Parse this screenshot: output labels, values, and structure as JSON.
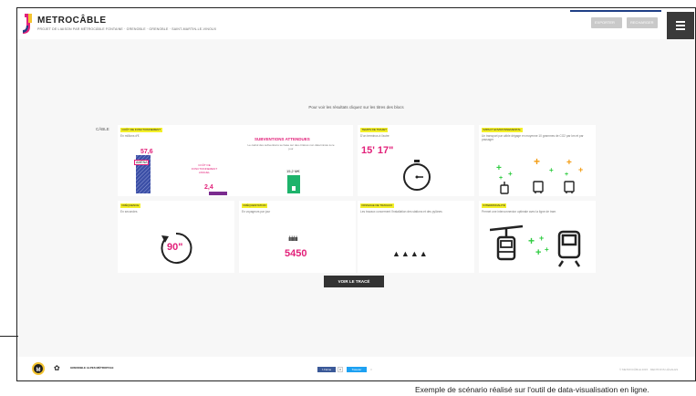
{
  "header": {
    "title": "METROCÂBLE",
    "subtitle": "PROJET DE LIAISON PAR MÉTROCÂBLE FONTAINE · GRENOBLE · GRENOBLE · SAINT-MARTIN-LE-VINOUX",
    "export_label": "EXPORTER",
    "reload_label": "RECHARGER",
    "brand_color": "#e2217a",
    "accent_color": "#f4f02a"
  },
  "main": {
    "intro": "Pour voir les résultats cliquez sur les titres des blocs",
    "section_label": "CÂBLE",
    "cards": {
      "cost": {
        "tag": "COÛT DE FONCTIONNEMENT",
        "desc": "En millions d'€",
        "value_top": "57,6",
        "value_mid": "COÛT DE FONCTIONNEMENT ANNUEL",
        "value_bottom": "2,4",
        "highlight": "AMÉNA"
      },
      "subsidies": {
        "title": "SUBVENTIONS ATTENDUES",
        "desc": "Le calcul des subventions se base sur des critères non déterminés à ce jour",
        "value": "15,2 M€"
      },
      "time": {
        "tag": "TEMPS DE TRAJET",
        "desc": "D'un terminus à l'autre",
        "value": "15'  17\""
      },
      "environment": {
        "tag": "IMPACT ENVIRONNEMENTAL",
        "desc": "Un transport par câble dégage en moyenne 10 grammes de CO2 par km et par passager"
      },
      "frequency": {
        "tag": "FRÉQUENCE",
        "desc": "En secondes",
        "value": "90\""
      },
      "ridership": {
        "tag": "FRÉQUENTATION",
        "desc": "En voyageurs par jour",
        "value": "5450",
        "people": "ılıılıılıılı"
      },
      "impact": {
        "tag": "PASSAGE DE TRAVAUX",
        "desc": "Les travaux concernent l'installation des stations et des pylônes",
        "value": "▲▲▲▲"
      },
      "intermodality": {
        "tag": "INTERMODALITÉ",
        "desc": "Permet une interconnexion optimale avec la ligne de tram"
      }
    },
    "trace_button": "VOIR LE TRACÉ"
  },
  "footer": {
    "logo_label": "M",
    "partner_name": "GRENOBLE ALPES MÉTROPOLE",
    "facebook_label": "f J'aime",
    "facebook_count": "0",
    "twitter_label": "Tweeter",
    "twitter_count": "0",
    "copyright": "© METROCÂBLE 2015 · MENTIONS LÉGALES"
  },
  "caption": "Exemple de scénario réalisé sur l'outil de data-visualisation en ligne."
}
